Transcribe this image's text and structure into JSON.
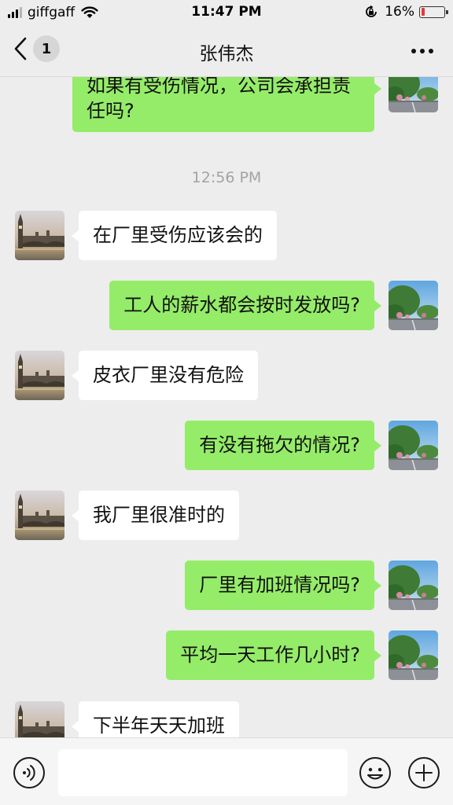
{
  "status_bar": {
    "carrier": "giffgaff",
    "time": "11:47 PM",
    "battery_percent": "16%",
    "battery_level": 0.16,
    "battery_color": "#e53935"
  },
  "nav": {
    "unread_count": "1",
    "title": "张伟杰",
    "back_icon": "chevron-left-icon",
    "more_icon": "more-icon"
  },
  "messages": [
    {
      "side": "out",
      "text": "如果有受伤情况，公司会承担责任吗?"
    },
    {
      "type": "timestamp",
      "text": "12:56 PM"
    },
    {
      "side": "in",
      "text": "在厂里受伤应该会的"
    },
    {
      "side": "out",
      "text": "工人的薪水都会按时发放吗?"
    },
    {
      "side": "in",
      "text": "皮衣厂里没有危险"
    },
    {
      "side": "out",
      "text": "有没有拖欠的情况?"
    },
    {
      "side": "in",
      "text": "我厂里很准时的"
    },
    {
      "side": "out",
      "text": "厂里有加班情况吗?"
    },
    {
      "side": "out",
      "text": "平均一天工作几小时?"
    },
    {
      "side": "in",
      "text": "下半年天天加班"
    }
  ],
  "input_bar": {
    "voice_icon": "voice-icon",
    "emoji_icon": "emoji-icon",
    "plus_icon": "plus-icon",
    "input_value": ""
  },
  "colors": {
    "outgoing_bubble": "#95ec69",
    "incoming_bubble": "#ffffff",
    "background": "#ededed"
  }
}
